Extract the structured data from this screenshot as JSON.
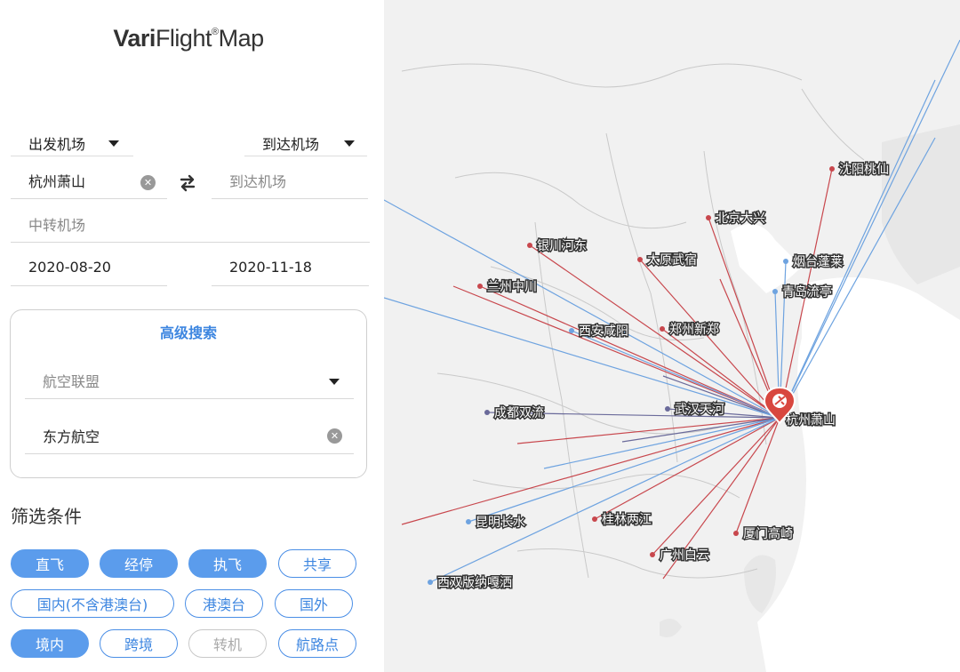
{
  "logo": {
    "bold": "Vari",
    "rest": "Flight",
    "sup": "®",
    "tail": "Map"
  },
  "dep_select": "出发机场",
  "arr_select": "到达机场",
  "dep_value": "杭州萧山",
  "arr_placeholder": "到达机场",
  "transfer_placeholder": "中转机场",
  "date_from": "2020-08-20",
  "date_to": "2020-11-18",
  "advanced": {
    "title": "高级搜索",
    "alliance_placeholder": "航空联盟",
    "airline_value": "东方航空"
  },
  "filter_title": "筛选条件",
  "chips": [
    {
      "label": "直飞",
      "state": "on"
    },
    {
      "label": "经停",
      "state": "on"
    },
    {
      "label": "执飞",
      "state": "on"
    },
    {
      "label": "共享",
      "state": "normal"
    },
    {
      "label": "国内(不含港澳台)",
      "state": "normal"
    },
    {
      "label": "港澳台",
      "state": "normal"
    },
    {
      "label": "国外",
      "state": "normal"
    },
    {
      "label": "境内",
      "state": "on"
    },
    {
      "label": "跨境",
      "state": "normal"
    },
    {
      "label": "转机",
      "state": "off"
    },
    {
      "label": "航路点",
      "state": "normal"
    }
  ],
  "map": {
    "hub": "杭州萧山",
    "route_colors": {
      "domestic": "#c8474d",
      "intl": "#6ea3e0",
      "stop": "#6a6a9a"
    },
    "city_labels": [
      "沈阳桃仙",
      "北京大兴",
      "银川河东",
      "太原武宿",
      "烟台蓬莱",
      "兰州中川",
      "青岛流亭",
      "西安咸阳",
      "郑州新郑",
      "武汉天河",
      "成都双流",
      "昆明长水",
      "桂林两江",
      "厦门高崎",
      "广州白云",
      "西双版纳嘎洒"
    ]
  }
}
